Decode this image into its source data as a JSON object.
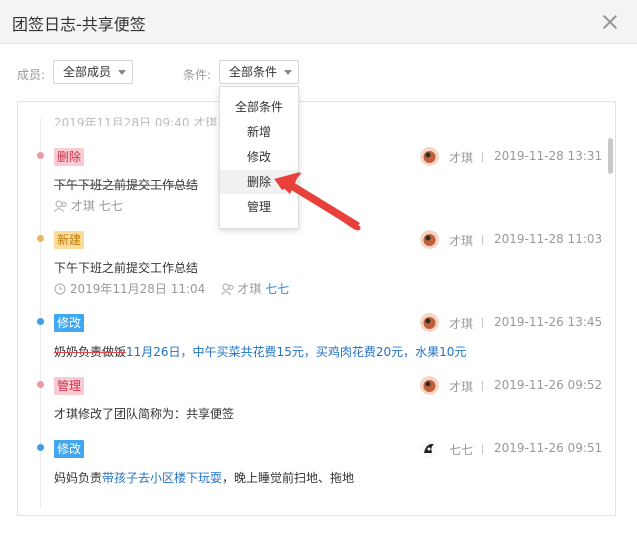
{
  "window": {
    "title": "团签日志-共享便签"
  },
  "filters": {
    "member_label": "成员:",
    "member_value": "全部成员",
    "condition_label": "条件:",
    "condition_value": "全部条件"
  },
  "dropdown": {
    "items": [
      "全部条件",
      "新增",
      "修改",
      "删除",
      "管理"
    ]
  },
  "top_partial": {
    "text": "2019年11月28日 09:40   才琪 七七"
  },
  "entries": [
    {
      "tag": "删除",
      "author": "才琪",
      "time": "2019-11-28 13:31",
      "content": "下午下班之前提交工作总结",
      "meta_author": "才琪",
      "meta_mention": "七七"
    },
    {
      "tag": "新建",
      "author": "才琪",
      "time": "2019-11-28 11:03",
      "content": "下午下班之前提交工作总结",
      "meta_date": "2019年11月28日 11:04",
      "meta_author": "才琪",
      "meta_mention": "七七"
    },
    {
      "tag": "修改",
      "author": "才琪",
      "time": "2019-11-26 13:45",
      "content_old": "奶奶负责做饭",
      "content_new": "11月26日，中午买菜共花费15元，买鸡肉花费20元，水果10元"
    },
    {
      "tag": "管理",
      "author": "才琪",
      "time": "2019-11-26 09:52",
      "content": "才琪修改了团队简称为：共享便签"
    },
    {
      "tag": "修改",
      "author": "七七",
      "time": "2019-11-26 09:51",
      "content_a": "妈妈负责",
      "content_b": "带孩子去小区楼下玩耍",
      "content_c": "，晚上睡觉前扫地、拖地"
    }
  ],
  "colors": {
    "tag_red": "#f8ccd3",
    "tag_yellow": "#fbdc9c",
    "tag_blue": "#41a7f1",
    "arrow": "#e8413c"
  }
}
